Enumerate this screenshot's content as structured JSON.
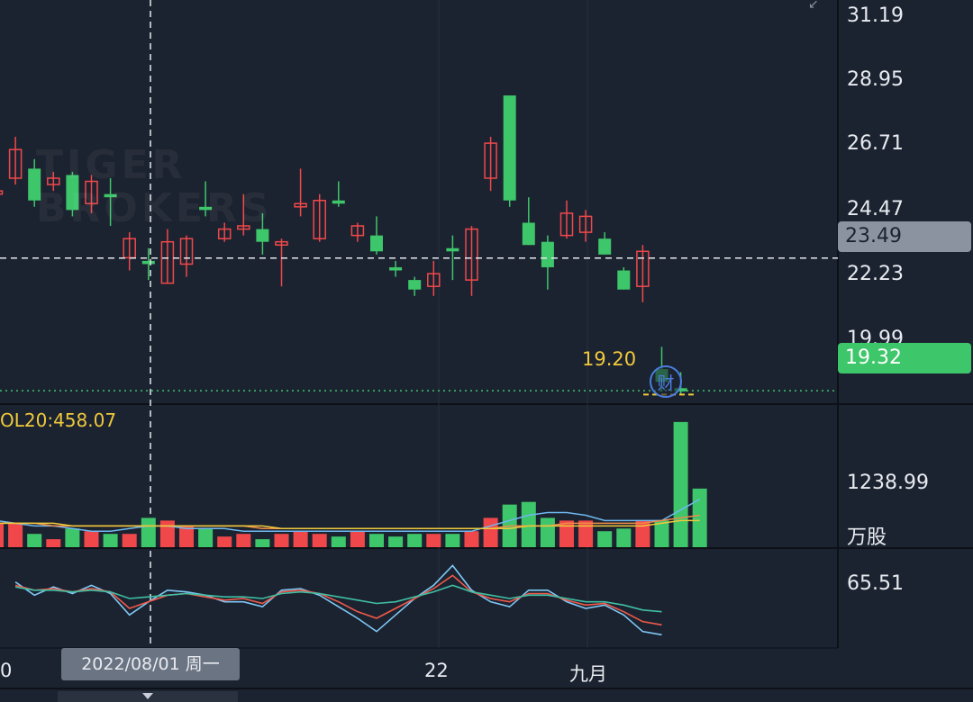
{
  "price_axis": {
    "ticks": [
      "31.19",
      "28.95",
      "26.71",
      "24.47",
      "22.23",
      "19.99"
    ],
    "crosshair_value": "23.49",
    "last_price": "19.32",
    "marker_price": "19.20",
    "earnings_icon": "财"
  },
  "volume_panel": {
    "label": "OL20:458.07",
    "tick": "1238.99",
    "unit": "万股"
  },
  "indicator_panel": {
    "tick": "65.51"
  },
  "x_axis": {
    "labels": [
      "0",
      "22",
      "九月"
    ],
    "crosshair_date": "2022/08/01 周一"
  },
  "watermark": {
    "line1": "TIGER",
    "line2": "BROKERS"
  },
  "colors": {
    "up": "#f0484a",
    "down": "#3ec66b",
    "background": "#1c2330",
    "ma_yellow": "#f0c93b",
    "ma_orange": "#f08c4a",
    "ma_blue": "#6fb8f0",
    "rsi_red": "#f05a4a",
    "rsi_green": "#3fbfa4",
    "rsi_blue": "#7ec8f5"
  },
  "chart_data": {
    "type": "candlestick",
    "x": [
      "0",
      "1",
      "2",
      "3",
      "4",
      "5",
      "6",
      "7",
      "8",
      "9",
      "10",
      "11",
      "12",
      "13",
      "14",
      "15",
      "16",
      "17",
      "18",
      "19",
      "20",
      "21",
      "22",
      "23",
      "24",
      "25",
      "26",
      "27",
      "28",
      "29",
      "30",
      "31",
      "32",
      "33",
      "34",
      "35"
    ],
    "candles": [
      {
        "o": 25.5,
        "c": 25.6,
        "h": 26.3,
        "l": 25.1
      },
      {
        "o": 26.0,
        "c": 26.9,
        "h": 27.3,
        "l": 25.8
      },
      {
        "o": 26.3,
        "c": 25.3,
        "h": 26.6,
        "l": 25.1
      },
      {
        "o": 25.8,
        "c": 26.0,
        "h": 26.2,
        "l": 25.6
      },
      {
        "o": 26.1,
        "c": 25.0,
        "h": 26.2,
        "l": 24.8
      },
      {
        "o": 25.2,
        "c": 25.9,
        "h": 26.1,
        "l": 24.9
      },
      {
        "o": 25.5,
        "c": 25.4,
        "h": 26.0,
        "l": 24.5
      },
      {
        "o": 23.5,
        "c": 24.1,
        "h": 24.3,
        "l": 23.1
      },
      {
        "o": 23.4,
        "c": 23.3,
        "h": 23.8,
        "l": 22.8
      },
      {
        "o": 22.7,
        "c": 24.0,
        "h": 24.4,
        "l": 22.7
      },
      {
        "o": 23.3,
        "c": 24.1,
        "h": 24.2,
        "l": 22.9
      },
      {
        "o": 25.1,
        "c": 25.0,
        "h": 25.9,
        "l": 24.8
      },
      {
        "o": 24.1,
        "c": 24.4,
        "h": 24.6,
        "l": 24.0
      },
      {
        "o": 24.4,
        "c": 24.5,
        "h": 25.5,
        "l": 24.2
      },
      {
        "o": 24.4,
        "c": 24.0,
        "h": 24.9,
        "l": 23.6
      },
      {
        "o": 23.9,
        "c": 24.0,
        "h": 24.1,
        "l": 22.6
      },
      {
        "o": 25.1,
        "c": 25.2,
        "h": 26.3,
        "l": 24.8
      },
      {
        "o": 24.1,
        "c": 25.3,
        "h": 25.5,
        "l": 24.0
      },
      {
        "o": 25.3,
        "c": 25.2,
        "h": 25.9,
        "l": 25.1
      },
      {
        "o": 24.2,
        "c": 24.5,
        "h": 24.6,
        "l": 24.0
      },
      {
        "o": 24.2,
        "c": 23.7,
        "h": 24.8,
        "l": 23.6
      },
      {
        "o": 23.2,
        "c": 23.1,
        "h": 23.4,
        "l": 22.9
      },
      {
        "o": 22.8,
        "c": 22.5,
        "h": 22.9,
        "l": 22.3
      },
      {
        "o": 22.6,
        "c": 23.0,
        "h": 23.4,
        "l": 22.3
      },
      {
        "o": 23.8,
        "c": 23.7,
        "h": 24.2,
        "l": 22.8
      },
      {
        "o": 22.8,
        "c": 24.4,
        "h": 24.5,
        "l": 22.3
      },
      {
        "o": 26.0,
        "c": 27.1,
        "h": 27.3,
        "l": 25.6
      },
      {
        "o": 28.6,
        "c": 25.3,
        "h": 28.6,
        "l": 25.1
      },
      {
        "o": 24.6,
        "c": 23.9,
        "h": 25.4,
        "l": 23.9
      },
      {
        "o": 24.0,
        "c": 23.2,
        "h": 24.2,
        "l": 22.5
      },
      {
        "o": 24.2,
        "c": 24.9,
        "h": 25.3,
        "l": 24.1
      },
      {
        "o": 24.3,
        "c": 24.8,
        "h": 25.0,
        "l": 24.0
      },
      {
        "o": 24.1,
        "c": 23.6,
        "h": 24.3,
        "l": 23.6
      },
      {
        "o": 23.1,
        "c": 22.5,
        "h": 23.2,
        "l": 22.5
      },
      {
        "o": 22.6,
        "c": 23.7,
        "h": 23.9,
        "l": 22.1
      },
      {
        "o": 20.0,
        "c": 19.6,
        "h": 20.7,
        "l": 19.3
      },
      {
        "o": 19.4,
        "c": 19.3,
        "h": 19.9,
        "l": 19.2
      }
    ],
    "volume": [
      9,
      9,
      5,
      3,
      7,
      6,
      5,
      5,
      11,
      10,
      8,
      7,
      4,
      5,
      3,
      5,
      6,
      5,
      4,
      6,
      5,
      4,
      5,
      5,
      5,
      6,
      11,
      16,
      17,
      11,
      10,
      10,
      6,
      7,
      10,
      10,
      47,
      22
    ],
    "ma_lines": [
      {
        "name": "MA-blue",
        "values": [
          10,
          9,
          8,
          8,
          7,
          6,
          6,
          7,
          8,
          8,
          7,
          7,
          7,
          6,
          6,
          6,
          6,
          6,
          6,
          6,
          6,
          6,
          6,
          6,
          6,
          6,
          8,
          10,
          12,
          13,
          13,
          12,
          10,
          10,
          10,
          10,
          14,
          18
        ]
      },
      {
        "name": "MA-orange",
        "values": [
          9,
          9,
          9,
          8,
          8,
          8,
          8,
          8,
          8,
          8,
          8,
          8,
          8,
          8,
          7,
          7,
          7,
          7,
          7,
          7,
          7,
          7,
          7,
          7,
          7,
          7,
          7,
          8,
          8,
          8,
          9,
          9,
          9,
          9,
          9,
          10,
          11,
          12
        ]
      },
      {
        "name": "MA-yellow",
        "values": [
          9,
          9,
          9,
          9,
          8,
          8,
          8,
          8,
          8,
          8,
          8,
          8,
          8,
          8,
          8,
          7,
          7,
          7,
          7,
          7,
          7,
          7,
          7,
          7,
          7,
          7,
          7,
          7,
          8,
          8,
          8,
          8,
          8,
          8,
          8,
          9,
          10,
          10
        ]
      }
    ],
    "indicator_lines": [
      {
        "name": "RSI-blue",
        "values": [
          60,
          52,
          57,
          53,
          58,
          53,
          40,
          48,
          55,
          54,
          52,
          48,
          48,
          45,
          55,
          56,
          52,
          45,
          38,
          30,
          40,
          50,
          58,
          70,
          55,
          48,
          45,
          55,
          55,
          48,
          44,
          46,
          40,
          30,
          28
        ]
      },
      {
        "name": "RSI-red",
        "values": [
          58,
          55,
          56,
          54,
          56,
          54,
          44,
          48,
          52,
          53,
          51,
          49,
          50,
          47,
          54,
          55,
          53,
          48,
          42,
          38,
          44,
          50,
          56,
          64,
          54,
          50,
          48,
          53,
          53,
          49,
          46,
          47,
          42,
          36,
          34
        ]
      },
      {
        "name": "RSI-green",
        "values": [
          57,
          55,
          55,
          54,
          55,
          54,
          50,
          51,
          52,
          53,
          52,
          51,
          51,
          50,
          53,
          54,
          53,
          51,
          49,
          47,
          48,
          51,
          54,
          58,
          54,
          52,
          50,
          52,
          52,
          50,
          48,
          48,
          46,
          43,
          42
        ]
      }
    ],
    "price_range": [
      18.9,
      31.6
    ],
    "volume_range": [
      0,
      50
    ],
    "indicator_range": [
      20,
      80
    ]
  }
}
